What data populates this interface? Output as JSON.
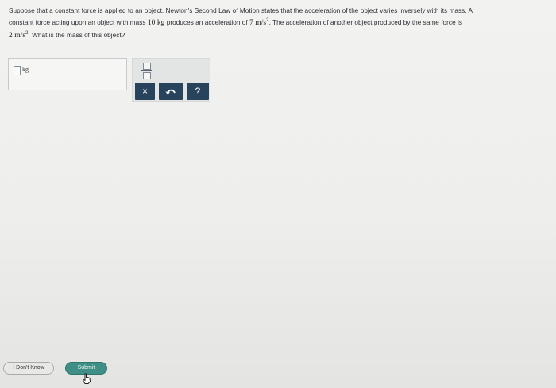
{
  "question": {
    "line1": "Suppose that a constant force is applied to an object. Newton's Second Law of Motion states that the acceleration of the object varies inversely with its mass. A",
    "line2_a": "constant force acting upon an object with mass ",
    "mass_value": "10 kg",
    "line2_b": " produces an acceleration of ",
    "accel1": "7 m/s",
    "exp": "2",
    "line2_c": ". The acceleration of another object produced by the same force is",
    "accel2": "2 m/s",
    "line3": ". What is the mass of this object?"
  },
  "answer": {
    "unit": "kg"
  },
  "toolbar": {
    "clear_label": "×",
    "help_label": "?"
  },
  "buttons": {
    "dont_know": "I Don't Know",
    "submit": "Submit"
  },
  "colors": {
    "toolbar_button": "#28435c",
    "submit_button": "#3f8f86"
  },
  "icons": [
    "fraction-icon",
    "clear-icon",
    "undo-icon",
    "help-icon",
    "hand-cursor-icon"
  ]
}
